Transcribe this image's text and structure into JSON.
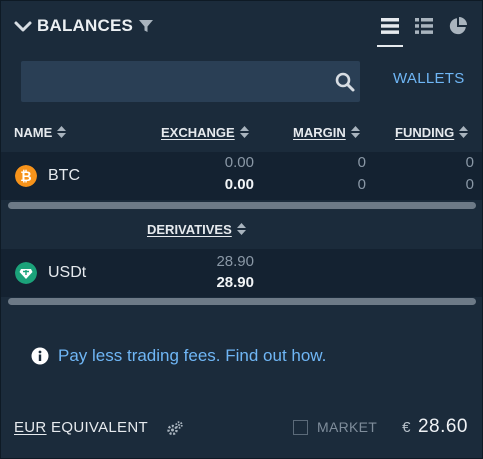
{
  "header": {
    "title": "BALANCES",
    "icons": [
      "chevron-down-icon",
      "filter-icon",
      "list-view-icon",
      "detailed-list-icon",
      "pie-chart-icon"
    ]
  },
  "search": {
    "value": "",
    "placeholder": ""
  },
  "wallets_link": "WALLETS",
  "columns": {
    "name": "NAME",
    "exchange": "EXCHANGE",
    "margin": "MARGIN",
    "funding": "FUNDING",
    "derivatives": "DERIVATIVES"
  },
  "wallet_rows": [
    {
      "coin": "BTC",
      "exchange_total": "0.00",
      "exchange_available": "0.00",
      "margin_total": "0",
      "margin_available": "0",
      "funding_total": "0",
      "funding_available": "0"
    }
  ],
  "derivative_rows": [
    {
      "coin": "USDt",
      "total": "28.90",
      "available": "28.90"
    }
  ],
  "promo": "Pay less trading fees. Find out how.",
  "footer": {
    "currency": "EUR",
    "equivalent_label": "EQUIVALENT",
    "market_label": "MARKET",
    "market_checked": false,
    "currency_symbol": "€",
    "total": "28.60"
  },
  "colors": {
    "panel_bg": "#1b2b3b",
    "row_bg": "#142231",
    "search_bg": "#2a3f55",
    "link": "#6fb6f5",
    "btc": "#f7931a",
    "usdt": "#1ba27a"
  }
}
